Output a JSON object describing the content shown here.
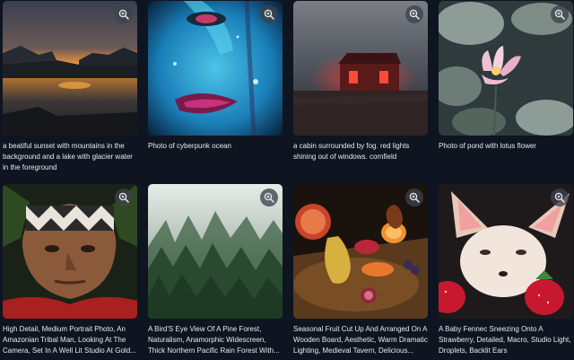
{
  "gallery": {
    "items": [
      {
        "caption": "a beatiful sunset with mountains in the background and a lake with glacier water in the foreground"
      },
      {
        "caption": "Photo of cyberpunk ocean"
      },
      {
        "caption": "a cabin surrounded by fog. red lights shining out of windows. cornfield"
      },
      {
        "caption": "Photo of pond with lotus flower"
      },
      {
        "caption": "High Detail, Medium Portrait Photo, An Amazonian Tribal Man, Looking At The Camera, Set In A Well Lit Studio At Gold..."
      },
      {
        "caption": "A Bird'S Eye View Of A Pine Forest, Naturalism, Anamorphic Widescreen, Thick Northern Pacific Rain Forest With..."
      },
      {
        "caption": "Seasonal Fruit Cut Up And Arranged On A Wooden Board, Aesthetic, Warm Dramatic Lighting, Medieval Tavern, Delicious..."
      },
      {
        "caption": "A Baby Fennec Sneezing Onto A Strawberry, Detailed, Macro, Studio Light, Droplets, Backlit Ears"
      }
    ],
    "zoom_icon": "zoom-in-icon"
  }
}
